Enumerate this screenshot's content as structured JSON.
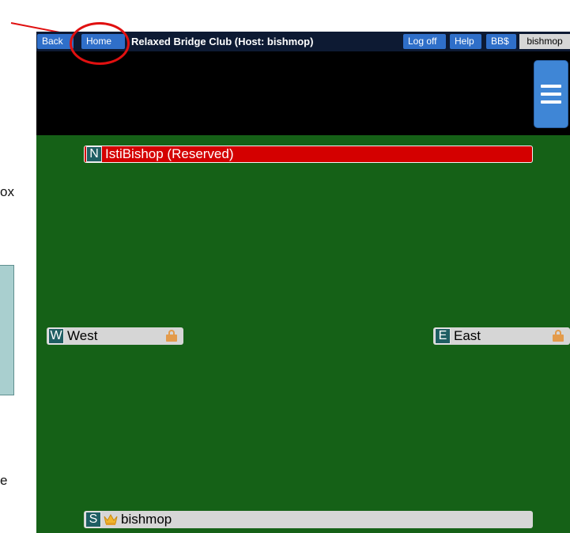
{
  "left_fragments": {
    "frag1": "ox",
    "frag2": "e"
  },
  "topbar": {
    "back_label": "Back",
    "home_label": "Home",
    "title": "Relaxed Bridge Club (Host: bishmop)",
    "logoff_label": "Log off",
    "help_label": "Help",
    "bbs_label": "BB$",
    "user_label": "bishmop"
  },
  "seats": {
    "north": {
      "dir": "N",
      "name": "IstiBishop (Reserved)"
    },
    "west": {
      "dir": "W",
      "name": "West"
    },
    "east": {
      "dir": "E",
      "name": "East"
    },
    "south": {
      "dir": "S",
      "name": "bishmop"
    }
  },
  "colors": {
    "table_green": "#156117",
    "topbar_bg": "#0d1a33",
    "button_blue": "#2f6fc9",
    "reserved_red": "#d40000",
    "annotation_red": "#e01010"
  },
  "icons": {
    "menu": "hamburger-menu-icon",
    "lock": "lock-icon",
    "crown": "crown-icon"
  }
}
